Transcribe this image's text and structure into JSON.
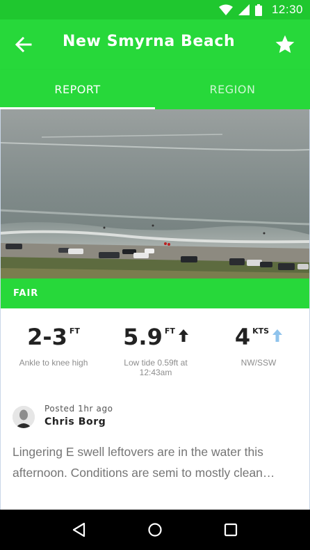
{
  "status_bar": {
    "time": "12:30"
  },
  "header": {
    "title": "New Smyrna Beach"
  },
  "tabs": [
    {
      "label": "REPORT",
      "active": true
    },
    {
      "label": "REGION",
      "active": false
    }
  ],
  "rating": {
    "label": "FAIR"
  },
  "conditions": {
    "surf": {
      "value": "2-3",
      "unit": "FT",
      "desc": "Ankle to knee high"
    },
    "tide": {
      "value": "5.9",
      "unit": "FT",
      "desc": "Low tide 0.59ft at 12:43am",
      "arrow_icon": "arrow-up-icon"
    },
    "wind": {
      "value": "4",
      "unit": "KTS",
      "desc": "NW/SSW",
      "arrow_icon": "arrow-up-icon"
    }
  },
  "report": {
    "posted": "Posted 1hr ago",
    "author": "Chris Borg",
    "body": "Lingering E swell leftovers are in the water this afternoon. Conditions are semi to mostly clean…"
  },
  "colors": {
    "brand_green": "#27d83a",
    "status_green": "#1fc72f",
    "wind_arrow": "#8fc3ec"
  }
}
